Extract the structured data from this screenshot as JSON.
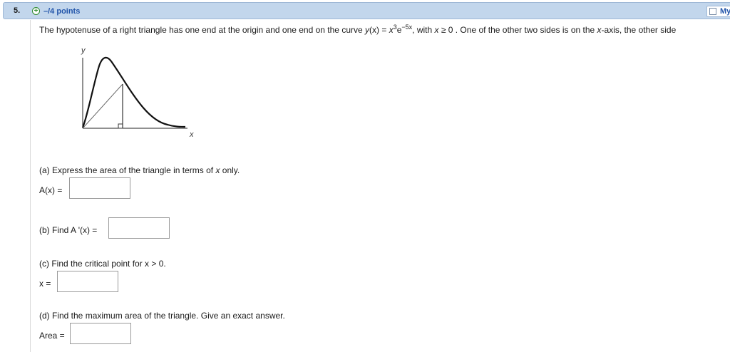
{
  "header": {
    "number": "5.",
    "points": "–/4 points",
    "notes_label": "My"
  },
  "problem": {
    "intro": "The hypotenuse of a right triangle has one end at the origin and one end on the curve ",
    "func_lhs": "y",
    "func_arg": "(x)",
    "equals": " = ",
    "base_var": "x",
    "exp1": "3",
    "e": "e",
    "exp2": "−5x",
    "cond_pre": ", with ",
    "cond_var": "x",
    "cond_rest": " ≥ 0 . One of the other two sides is on the ",
    "axis_name": "x",
    "tail": "-axis, the other side"
  },
  "graph": {
    "y_label": "y",
    "x_label": "x"
  },
  "parts": {
    "a": {
      "question_pre": "(a) Express the area of the triangle in terms of ",
      "question_var": "x",
      "question_post": " only.",
      "label": "A(x) =",
      "value": ""
    },
    "b": {
      "question": "(b) Find A '(x) =",
      "value": ""
    },
    "c": {
      "question": "(c) Find the critical point for x > 0.",
      "label": "x =",
      "value": ""
    },
    "d": {
      "question": "(d) Find the maximum area of the triangle. Give an exact answer.",
      "label": "Area =",
      "value": ""
    }
  }
}
